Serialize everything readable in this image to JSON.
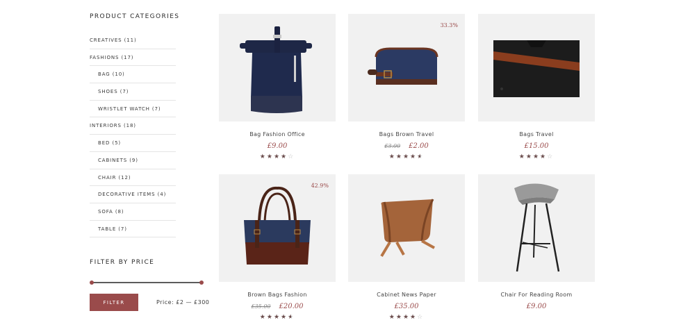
{
  "sidebar": {
    "categories_title": "PRODUCT CATEGORIES",
    "categories": [
      {
        "label": "CREATIVES (11)",
        "sub": false
      },
      {
        "label": "FASHIONS (17)",
        "sub": false
      },
      {
        "label": "BAG (10)",
        "sub": true
      },
      {
        "label": "SHOES (7)",
        "sub": true
      },
      {
        "label": "WRISTLET WATCH (7)",
        "sub": true
      },
      {
        "label": "INTERIORS (18)",
        "sub": false
      },
      {
        "label": "BED (5)",
        "sub": true
      },
      {
        "label": "CABINETS (9)",
        "sub": true
      },
      {
        "label": "CHAIR (12)",
        "sub": true
      },
      {
        "label": "DECORATIVE ITEMS (4)",
        "sub": true
      },
      {
        "label": "SOFA (8)",
        "sub": true
      },
      {
        "label": "TABLE (7)",
        "sub": true
      }
    ],
    "price_title": "FILTER BY PRICE",
    "filter_label": "FILTER",
    "price_range_text": "Price: £2 — £300"
  },
  "colors": {
    "accent": "#9a4b4b",
    "thumb_bg": "#f1f1f1",
    "star": "#6a4c4c"
  },
  "products": [
    {
      "name": "Bag Fashion Office",
      "old_price": "",
      "price": "£9.00",
      "discount": "",
      "rating": 4,
      "image": "navy-rolltop-backpack"
    },
    {
      "name": "Bags Brown Travel",
      "old_price": "£3.00",
      "price": "£2.00",
      "discount": "33.3%",
      "rating": 4.5,
      "image": "navy-toiletry-bag"
    },
    {
      "name": "Bags Travel",
      "old_price": "",
      "price": "£15.00",
      "discount": "",
      "rating": 4,
      "image": "black-card-wallet"
    },
    {
      "name": "Brown Bags Fashion",
      "old_price": "£35.00",
      "price": "£20.00",
      "discount": "42.9%",
      "rating": 4.5,
      "image": "navy-brown-tote-bag"
    },
    {
      "name": "Cabinet News Paper",
      "old_price": "",
      "price": "£35.00",
      "discount": "",
      "rating": 4,
      "image": "wooden-magazine-rack"
    },
    {
      "name": "Chair For Reading Room",
      "old_price": "",
      "price": "£9.00",
      "discount": "",
      "rating": 0,
      "image": "concrete-bar-stool"
    }
  ]
}
